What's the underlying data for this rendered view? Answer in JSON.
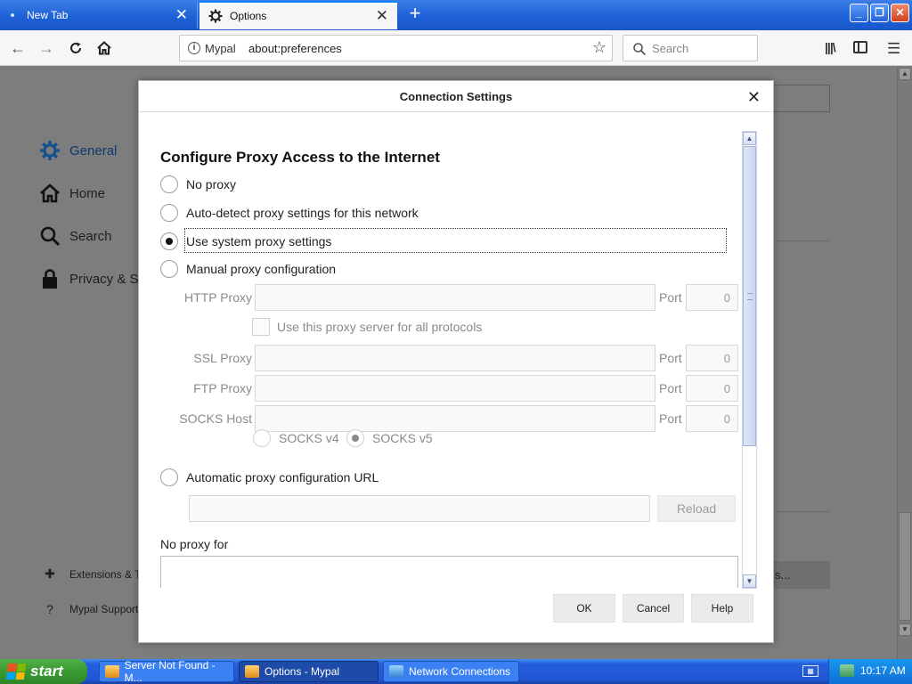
{
  "tabs": [
    {
      "label": "New Tab",
      "active": false
    },
    {
      "label": "Options",
      "active": true
    }
  ],
  "navbar": {
    "identity": "Mypal",
    "url": "about:preferences",
    "search_placeholder": "Search"
  },
  "pref_sidebar": {
    "categories": [
      {
        "label": "General",
        "icon": "gear-icon",
        "selected": true
      },
      {
        "label": "Home",
        "icon": "home-icon"
      },
      {
        "label": "Search",
        "icon": "search-icon"
      },
      {
        "label": "Privacy & Se",
        "icon": "lock-icon"
      }
    ],
    "footer": [
      {
        "label": "Extensions & T",
        "icon": "puzzle-icon"
      },
      {
        "label": "Mypal Support",
        "icon": "help-icon"
      }
    ]
  },
  "background_button_label": "s...",
  "dialog": {
    "title": "Connection Settings",
    "heading": "Configure Proxy Access to the Internet",
    "proxy_options": {
      "no_proxy": "No proxy",
      "auto_detect": "Auto-detect proxy settings for this network",
      "system": "Use system proxy settings",
      "manual": "Manual proxy configuration",
      "pac": "Automatic proxy configuration URL",
      "selected": "system"
    },
    "manual": {
      "http_label": "HTTP Proxy",
      "ssl_label": "SSL Proxy",
      "ftp_label": "FTP Proxy",
      "socks_label": "SOCKS Host",
      "port_label": "Port",
      "http_port": "0",
      "ssl_port": "0",
      "ftp_port": "0",
      "socks_port": "0",
      "share_checkbox": "Use this proxy server for all protocols",
      "socks_v4": "SOCKS v4",
      "socks_v5": "SOCKS v5",
      "socks_selected": "v5"
    },
    "reload_label": "Reload",
    "no_proxy_for_label": "No proxy for",
    "buttons": {
      "ok": "OK",
      "cancel": "Cancel",
      "help": "Help"
    }
  },
  "taskbar": {
    "start_label": "start",
    "tasks": [
      {
        "label": "Server Not Found - M..."
      },
      {
        "label": "Options - Mypal",
        "active": true
      },
      {
        "label": "Network Connections"
      }
    ],
    "clock": "10:17 AM"
  },
  "colors": {
    "accent": "#0a84ff",
    "xp_taskbar_blue": "#245edb",
    "xp_start_green": "#3a9a31",
    "overlay_gray": "#7d7d7d"
  }
}
